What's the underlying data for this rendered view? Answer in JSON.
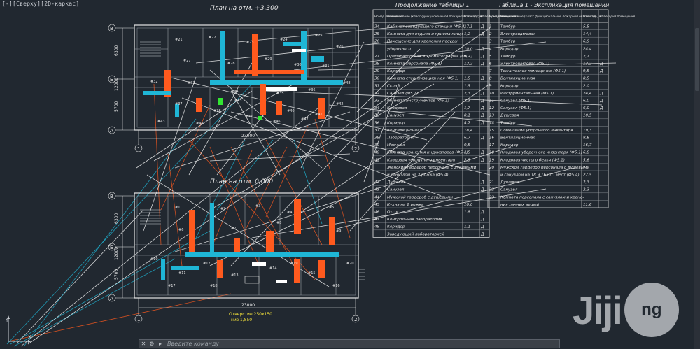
{
  "viewport": {
    "label": "[-][Сверху][2D-каркас]"
  },
  "plans": {
    "upper_title": "План на отм. +3,300",
    "lower_title": "План на отм. 0,000",
    "axis_letters": [
      "В",
      "Б",
      "А"
    ],
    "axis_numbers": [
      "1",
      "2"
    ],
    "dims_side": [
      "6300",
      "12000",
      "5700"
    ],
    "dim_overall": "23000",
    "note_lower_1": "Отверстие 250х150",
    "note_lower_2": "низ 1,850",
    "room_numbers_upper": [
      "#21",
      "#22",
      "#23",
      "#24",
      "#25",
      "#26",
      "#27",
      "#28",
      "#29",
      "#30",
      "#31",
      "#32",
      "#33",
      "#34",
      "#35",
      "#36",
      "#37",
      "#38",
      "#39",
      "#40",
      "#41",
      "#42",
      "#43",
      "#44",
      "#45",
      "#46",
      "#47",
      "#48"
    ],
    "room_numbers_lower": [
      "#1",
      "#2",
      "#3",
      "#4",
      "#5",
      "#6",
      "#7",
      "#8",
      "#9",
      "#10",
      "#11",
      "#12",
      "#13",
      "#14",
      "#15",
      "#16",
      "#17",
      "#18",
      "#19",
      "#20"
    ]
  },
  "table_left": {
    "title": "Продолжение таблицы 1",
    "headers": [
      "Номер помещения",
      "Наименование (класс функциональной пожарной опасности)",
      "Площадь, м²",
      "Категория помещения"
    ],
    "rows": [
      [
        "24",
        "Кабинет заведующего станции (Ф5.4)",
        "17,1",
        "Д"
      ],
      [
        "25",
        "Комната для отдыха и приема пищи",
        "1,2",
        "Д"
      ],
      [
        "26",
        "Помещение для хранения посуды",
        "",
        ""
      ],
      [
        "",
        "уборочного",
        "10,0",
        "Д"
      ],
      [
        "27",
        "Препараторская и хроматография (Ф5.1)",
        "9,2",
        "Д"
      ],
      [
        "28",
        "Комната персонала (Ф5.1)",
        "12,2",
        "Д"
      ],
      [
        "29",
        "Коридор",
        "",
        ""
      ],
      [
        "30",
        "Комната стерилизационная (Ф5.1)",
        "1,5",
        "Д"
      ],
      [
        "31",
        "Склад",
        "1,5",
        ""
      ],
      [
        "32",
        "Санузел (Ф5.1)",
        "2,3",
        "Д"
      ],
      [
        "33",
        "Комната инструментов (Ф5.1)",
        "2,3",
        "Д"
      ],
      [
        "34",
        "Кладовая",
        "1,7",
        "Д"
      ],
      [
        "35",
        "Санузел",
        "8,1",
        "Д"
      ],
      [
        "36",
        "Коридор",
        "4,7",
        "Д"
      ],
      [
        "37",
        "Вентиляционная",
        "18,4",
        ""
      ],
      [
        "38",
        "Лаборатория",
        "6,7",
        "Д"
      ],
      [
        "39",
        "Моечная",
        "0,5",
        ""
      ],
      [
        "40",
        "Комната хранения индикаторов (Ф5.4)",
        "1,5",
        "Д"
      ],
      [
        "41",
        "Кладовая уборочного инвентаря",
        "2,9",
        "Д"
      ],
      [
        "",
        "Женский гардероб персонала с душевыми",
        "",
        ""
      ],
      [
        "",
        "и санузлом на 2 рожка (Ф5.4)",
        "",
        ""
      ],
      [
        "42",
        "Душевая",
        "",
        "Д"
      ],
      [
        "43",
        "Санузел",
        "",
        "Д"
      ],
      [
        "44",
        "Мужской гардероб с душевыми",
        "",
        ""
      ],
      [
        "45",
        "Кухня на 2 рожка",
        "10,0",
        ""
      ],
      [
        "46",
        "Отсос",
        "1,8",
        "Д"
      ],
      [
        "47",
        "Контрольная лаборатория",
        "",
        "Д"
      ],
      [
        "48",
        "Коридор",
        "1,1",
        "Д"
      ],
      [
        "",
        "Заведующий лабораторией",
        "",
        "Д"
      ]
    ]
  },
  "table_right": {
    "title": "Таблица 1 - Экспликация помещений",
    "headers": [
      "Номер помещения",
      "Наименование (класс функциональной пожарной опасности)",
      "Площадь, м²",
      "Категория помещения"
    ],
    "rows": [
      [
        "1",
        "Тамбур",
        "5,5",
        ""
      ],
      [
        "2",
        "Электрощитовая",
        "14,4",
        ""
      ],
      [
        "3",
        "Тамбур",
        "6,9",
        ""
      ],
      [
        "4",
        "Коридор",
        "24,4",
        ""
      ],
      [
        "5",
        "Тамбур",
        "2,7",
        ""
      ],
      [
        "6",
        "Электрощитовая (Ф5.1)",
        "13,2",
        "Д"
      ],
      [
        "7",
        "Техническое помещение (Ф5.1)",
        "9,5",
        "Д"
      ],
      [
        "8",
        "Вентиляционная",
        "8,5",
        ""
      ],
      [
        "9",
        "Коридор",
        "2,0",
        ""
      ],
      [
        "10",
        "Инструментальная (Ф5.1)",
        "24,4",
        "Д"
      ],
      [
        "11",
        "Санузел (Ф5.1)",
        "6,0",
        "Д"
      ],
      [
        "12",
        "Санузел (Ф5.1)",
        "6,0",
        "Д"
      ],
      [
        "13",
        "Душевая",
        "10,5",
        ""
      ],
      [
        "14",
        "Тамбур",
        "",
        ""
      ],
      [
        "15",
        "Помещение уборочного инвентаря",
        "19,3",
        ""
      ],
      [
        "16",
        "Вентиляционная",
        "8,6",
        ""
      ],
      [
        "17",
        "Коридор",
        "16,7",
        ""
      ],
      [
        "18",
        "Кладовая уборочного инвентаря (Ф5.1)",
        "6,8",
        ""
      ],
      [
        "19",
        "Кладовая чистого белья (Ф5.1)",
        "5,6",
        ""
      ],
      [
        "20",
        "Мужской гардероб персонала с душевыми",
        "",
        ""
      ],
      [
        "",
        "и санузлом на 18 и 16 шт. мест (Ф5.4)",
        "27,5",
        ""
      ],
      [
        "21",
        "Душевая",
        "2,3",
        ""
      ],
      [
        "22",
        "Санузел",
        "2,3",
        ""
      ],
      [
        "23",
        "Комната персонала с санузлом и хране-",
        "",
        ""
      ],
      [
        "",
        "ния личных вещей",
        "11,6",
        ""
      ]
    ]
  },
  "ducts": {
    "colors": {
      "orange": "#ff5a1e",
      "cyan": "#1fb6d6",
      "white": "#ffffff",
      "green": "#32e632",
      "yellow": "#f2e03a",
      "gray": "#d0d0d0"
    }
  },
  "command": {
    "placeholder": "Введите команду",
    "close_icon": "close-icon",
    "settings_icon": "wrench-icon",
    "recent_icon": "chevron-up-icon"
  },
  "watermark": {
    "text": "Jiji",
    "circle": "ng"
  }
}
